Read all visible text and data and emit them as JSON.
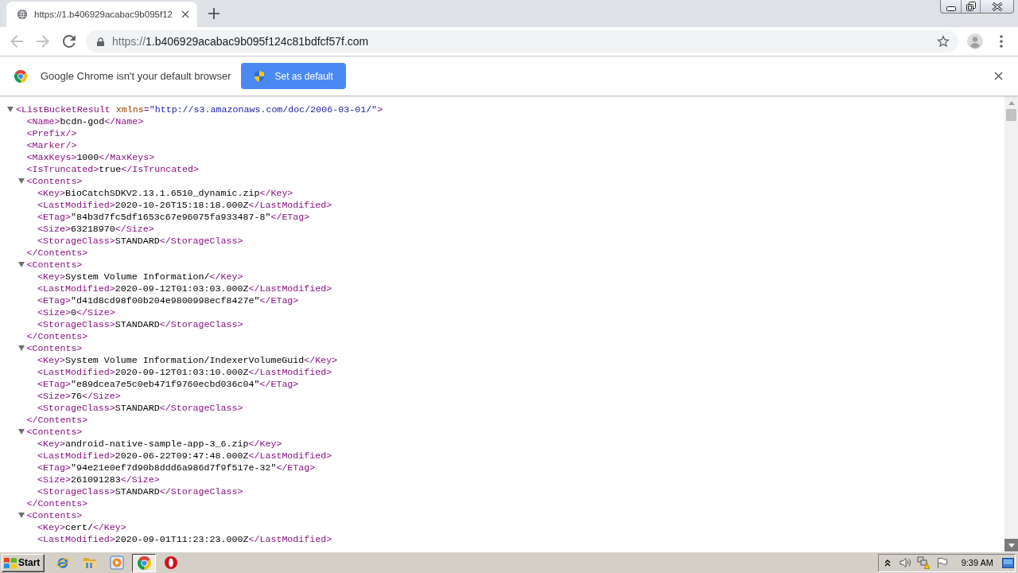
{
  "browser": {
    "tabs": [
      {
        "title": "https://1.b406929acabac9b095f12",
        "selected": true
      }
    ],
    "toolbar": {
      "buttons": [
        {
          "kind": "back",
          "disabled": true
        },
        {
          "kind": "forward",
          "disabled": true
        },
        {
          "kind": "reload",
          "disabled": false
        }
      ]
    },
    "address_bar": {
      "scheme": "https://",
      "host": "1.b406929acabac9b095f124c81bdfcf57f.com"
    },
    "infobar": {
      "message": "Google Chrome isn't your default browser",
      "button": "Set as default"
    }
  },
  "xml_tree": {
    "open": "<ListBucketResult",
    "attributes": [
      {
        "name": "xmlns",
        "separator": "=",
        "value": "\"http://s3.amazonaws.com/doc/2006-03-01/\""
      }
    ],
    "open_end": ">",
    "expanded": true,
    "children": [
      {
        "open": "<Name>",
        "text": "bcdn-god",
        "close": "</Name>"
      },
      {
        "open": "<Prefix/>"
      },
      {
        "open": "<Marker/>"
      },
      {
        "open": "<MaxKeys>",
        "text": "1000",
        "close": "</MaxKeys>"
      },
      {
        "open": "<IsTruncated>",
        "text": "true",
        "close": "</IsTruncated>"
      },
      {
        "open": "<Contents>",
        "expanded": true,
        "close": "</Contents>",
        "children": [
          {
            "open": "<Key>",
            "text": "BioCatchSDKV2.13.1.6510_dynamic.zip",
            "close": "</Key>"
          },
          {
            "open": "<LastModified>",
            "text": "2020-10-26T15:18:18.000Z",
            "close": "</LastModified>"
          },
          {
            "open": "<ETag>",
            "text": "\"84b3d7fc5df1653c67e96075fa933487-8\"",
            "close": "</ETag>"
          },
          {
            "open": "<Size>",
            "text": "63218970",
            "close": "</Size>"
          },
          {
            "open": "<StorageClass>",
            "text": "STANDARD",
            "close": "</StorageClass>"
          }
        ]
      },
      {
        "open": "<Contents>",
        "expanded": true,
        "close": "</Contents>",
        "children": [
          {
            "open": "<Key>",
            "text": "System Volume Information/",
            "close": "</Key>"
          },
          {
            "open": "<LastModified>",
            "text": "2020-09-12T01:03:03.000Z",
            "close": "</LastModified>"
          },
          {
            "open": "<ETag>",
            "text": "\"d41d8cd98f00b204e9800998ecf8427e\"",
            "close": "</ETag>"
          },
          {
            "open": "<Size>",
            "text": "0",
            "close": "</Size>"
          },
          {
            "open": "<StorageClass>",
            "text": "STANDARD",
            "close": "</StorageClass>"
          }
        ]
      },
      {
        "open": "<Contents>",
        "expanded": true,
        "close": "</Contents>",
        "children": [
          {
            "open": "<Key>",
            "text": "System Volume Information/IndexerVolumeGuid",
            "close": "</Key>"
          },
          {
            "open": "<LastModified>",
            "text": "2020-09-12T01:03:10.000Z",
            "close": "</LastModified>"
          },
          {
            "open": "<ETag>",
            "text": "\"e89dcea7e5c0eb471f9760ecbd036c04\"",
            "close": "</ETag>"
          },
          {
            "open": "<Size>",
            "text": "76",
            "close": "</Size>"
          },
          {
            "open": "<StorageClass>",
            "text": "STANDARD",
            "close": "</StorageClass>"
          }
        ]
      },
      {
        "open": "<Contents>",
        "expanded": true,
        "close": "</Contents>",
        "children": [
          {
            "open": "<Key>",
            "text": "android-native-sample-app-3_6.zip",
            "close": "</Key>"
          },
          {
            "open": "<LastModified>",
            "text": "2020-06-22T09:47:48.000Z",
            "close": "</LastModified>"
          },
          {
            "open": "<ETag>",
            "text": "\"94e21e0ef7d90b8ddd6a986d7f9f517e-32\"",
            "close": "</ETag>"
          },
          {
            "open": "<Size>",
            "text": "261091283",
            "close": "</Size>"
          },
          {
            "open": "<StorageClass>",
            "text": "STANDARD",
            "close": "</StorageClass>"
          }
        ]
      },
      {
        "open": "<Contents>",
        "expanded": true,
        "children": [
          {
            "open": "<Key>",
            "text": "cert/",
            "close": "</Key>"
          },
          {
            "open": "<LastModified>",
            "text": "2020-09-01T11:23:23.000Z",
            "close": "</LastModified>"
          }
        ]
      }
    ]
  },
  "taskbar": {
    "start": "Start",
    "apps": [
      {
        "kind": "ie",
        "selected": false
      },
      {
        "kind": "folder",
        "selected": false
      },
      {
        "kind": "player",
        "selected": false
      },
      {
        "kind": "chrome",
        "selected": true
      },
      {
        "kind": "ring",
        "selected": false
      }
    ],
    "clock": "9:39 AM"
  }
}
